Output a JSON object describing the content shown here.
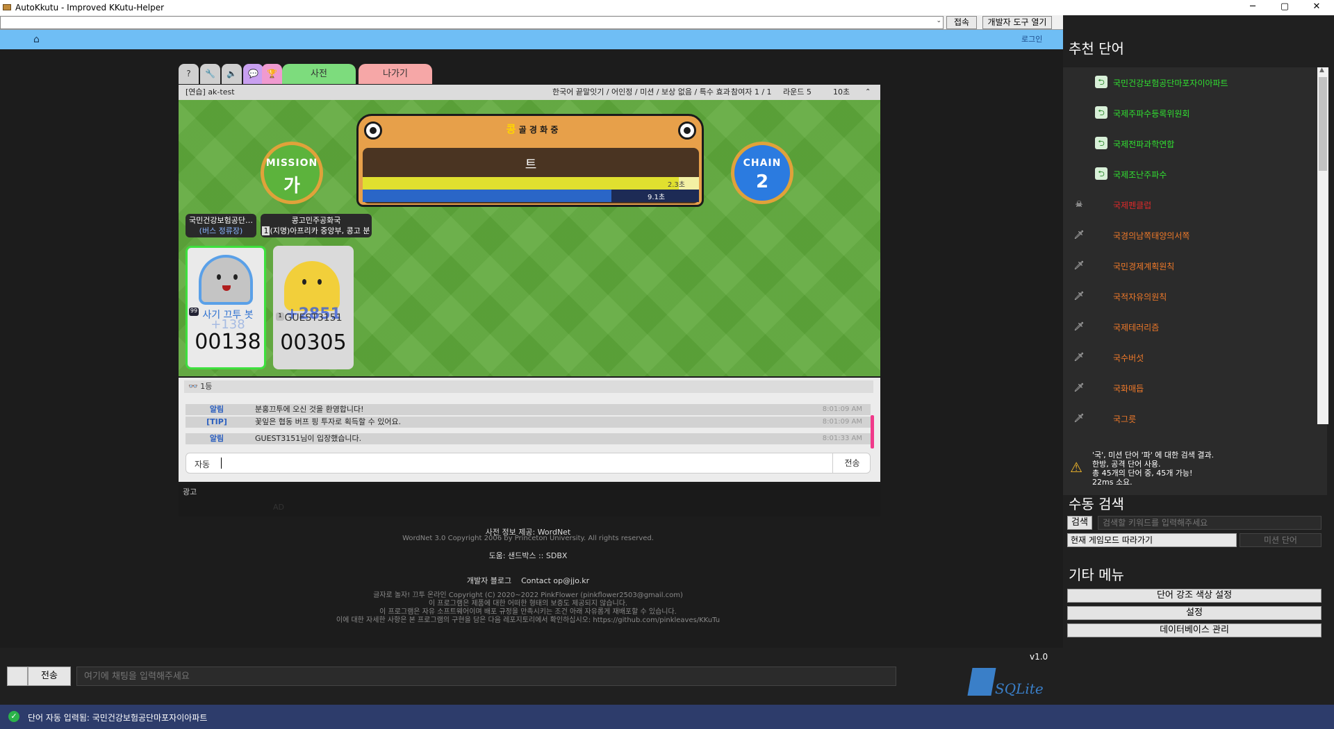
{
  "window": {
    "title": "AutoKkutu - Improved KKutu-Helper",
    "minimize": "─",
    "maximize": "▢",
    "close": "✕"
  },
  "topbar": {
    "url": "",
    "connect": "접속",
    "devtools": "개발자 도구 열기"
  },
  "nav": {
    "login": "로그인"
  },
  "tabs": {
    "dict": "사전",
    "exit": "나가기"
  },
  "room": {
    "name": "[연습] ak-test",
    "info": "한국어 끝말잇기 / 어인정 / 미션 / 보상 없음 / 특수 효과",
    "players": "참여자 1 / 1",
    "round": "라운드 5",
    "time": "10초"
  },
  "board": {
    "syllables": [
      "콩",
      "골",
      "경",
      "화",
      "중"
    ],
    "current": "트",
    "round_time": "2.3초",
    "round_fraction": 0.94,
    "turn_time": "9.1초",
    "turn_fraction": 0.74
  },
  "mission": {
    "title": "MISSION",
    "value": "가"
  },
  "chain": {
    "title": "CHAIN",
    "value": "2"
  },
  "hints": [
    {
      "word": "국민건강보험공단…",
      "desc": "(버스 정류장)"
    },
    {
      "word": "콩고민주공화국",
      "badge": "1",
      "desc": "(지명)아프리카 중앙부, 콩고 분지 대부…"
    }
  ],
  "players": [
    {
      "name": "사기 끄투 봇",
      "score": "00138",
      "gain": "+138",
      "level": "99"
    },
    {
      "name": "GUEST3151",
      "score": "00305",
      "gain": "+2851",
      "level": "1"
    }
  ],
  "chat": {
    "rank": "1등",
    "rows": [
      {
        "who": "알림",
        "msg": "분홍끄투에 오신 것을 환영합니다!",
        "time": "8:01:09 AM"
      },
      {
        "who": "[TIP]",
        "msg": "꽃잎은 협동 버프 핑 투자로 획득할 수 있어요.",
        "time": "8:01:09 AM"
      },
      {
        "who": "알림",
        "msg": "GUEST3151님이 입장했습니다.",
        "time": "8:01:33 AM"
      }
    ],
    "auto": "자동",
    "send": "전송"
  },
  "ad": {
    "label": "광고",
    "ad": "AD"
  },
  "footer": {
    "dict_source": "사전 정보 제공: WordNet",
    "wordnet": "WordNet 3.0 Copyright 2006 by Princeton University. All rights reserved.",
    "help": "도움: 샌드박스 :: SDBX",
    "blog": "개발자 블로그",
    "contact": "Contact op@jjo.kr",
    "license1": "글자로 놀자! 끄투 온라인 Copyright (C) 2020~2022 PinkFlower (pinkflower2503@gmail.com)",
    "license2": "이 프로그램은 제품에 대한 어떠한 형태의 보증도 제공되지 않습니다.",
    "license3": "이 프로그램은 자유 소프트웨어이며 배포 규정을 만족시키는 조건 아래 자유롭게 재배포할 수 있습니다.",
    "license4": "이에 대한 자세한 사항은 본 프로그램의 구현을 담은 다음 레포지토리에서 확인하십시오: https://github.com/pinkleaves/KKuTu"
  },
  "right": {
    "recommend_title": "추천 단어",
    "words": [
      {
        "text": "국민건강보험공단마포자이아파트",
        "icon": "green-arrow-icon",
        "color": "#31e031"
      },
      {
        "text": "국제주파수등록위원회",
        "icon": "green-arrow-icon",
        "color": "#31e031"
      },
      {
        "text": "국제전파과학연합",
        "icon": "green-arrow-icon",
        "color": "#31e031"
      },
      {
        "text": "국제조난주파수",
        "icon": "green-arrow-icon",
        "color": "#31e031"
      },
      {
        "text": "국제펜클럽",
        "icon": "skull-icon",
        "color": "#e02a2a"
      },
      {
        "text": "국경의남쪽태양의서쪽",
        "icon": "sword-icon",
        "color": "#f07a2a"
      },
      {
        "text": "국민경제계획원칙",
        "icon": "sword-icon",
        "color": "#f07a2a"
      },
      {
        "text": "국적자유의원칙",
        "icon": "sword-icon",
        "color": "#f07a2a"
      },
      {
        "text": "국제테러리즘",
        "icon": "sword-icon",
        "color": "#f07a2a"
      },
      {
        "text": "국수버섯",
        "icon": "sword-icon",
        "color": "#f07a2a"
      },
      {
        "text": "국화매듭",
        "icon": "sword-icon",
        "color": "#f07a2a"
      },
      {
        "text": "국그릇",
        "icon": "sword-icon",
        "color": "#f07a2a"
      }
    ],
    "result_lines": [
      "'국', 미션 단어 '파' 에 대한 검색 결과.",
      "한방, 공격 단어 사용.",
      "총 45개의 단어 중, 45개 가능!",
      "22ms 소요."
    ],
    "manual_title": "수동 검색",
    "search_btn": "검색",
    "search_placeholder": "검색할 키워드를 입력해주세요",
    "mode_select": "현재 게임모드 따라가기",
    "mission_placeholder": "미션 단어",
    "etc_title": "기타 메뉴",
    "btn_color": "단어 강조 색상 설정",
    "btn_settings": "설정",
    "btn_db": "데이터베이스 관리",
    "db_logo": "SQLite"
  },
  "bottom": {
    "version": "v1.0",
    "send": "전송",
    "chat_placeholder": "여기에 채팅을 입력해주세요",
    "status": "단어 자동 입력됨: 국민건강보험공단마포자이아파트"
  }
}
